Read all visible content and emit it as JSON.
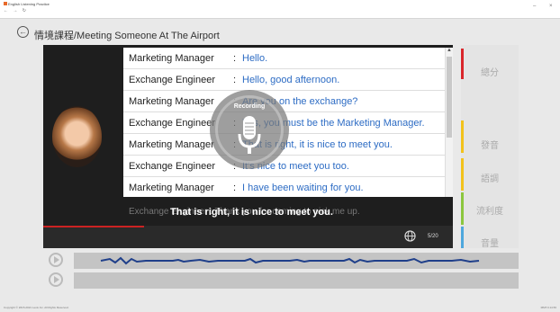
{
  "window": {
    "title": "English Listening Practice",
    "nav": "← → ↻",
    "minimize": "–",
    "close": "×"
  },
  "header": {
    "back_icon": "←",
    "title": "情境課程/Meeting Someone At The Airport"
  },
  "dialog": {
    "rows": [
      {
        "speaker": "Marketing Manager",
        "colon": ":",
        "text": "Hello."
      },
      {
        "speaker": "Exchange Engineer",
        "colon": ":",
        "text": "Hello, good afternoon."
      },
      {
        "speaker": "Marketing Manager",
        "colon": ":",
        "text": "Are you on the exchange?"
      },
      {
        "speaker": "Exchange Engineer",
        "colon": ":",
        "text": "Yes, you must be the Marketing Manager."
      },
      {
        "speaker": "Marketing Manager",
        "colon": ":",
        "text": "That is right, it is nice to meet you."
      },
      {
        "speaker": "Exchange Engineer",
        "colon": ":",
        "text": "It's nice to meet you too."
      },
      {
        "speaker": "Marketing Manager",
        "colon": ":",
        "text": "I have been waiting for you."
      }
    ],
    "partial_row": "Exchange Engineer : Thank you for coming to pick me up."
  },
  "recording": {
    "label": "Recording",
    "icon": "microphone-icon"
  },
  "subtitle": "That is right, it is nice to meet you.",
  "counter": "5/20",
  "globe_icon": "globe-icon",
  "right_panel": {
    "items": [
      {
        "label": "總分",
        "color": "#d9262b"
      },
      {
        "label": "發音",
        "color": "#f2c21c"
      },
      {
        "label": "語調",
        "color": "#f2c21c"
      },
      {
        "label": "流利度",
        "color": "#8cc63e"
      },
      {
        "label": "音量",
        "color": "#4ea7dd"
      }
    ]
  },
  "footer": {
    "left": "Copyright © 2015-2021 Lexis Inc. All Rights Reserved.",
    "right": "MMT.3.14.56"
  }
}
